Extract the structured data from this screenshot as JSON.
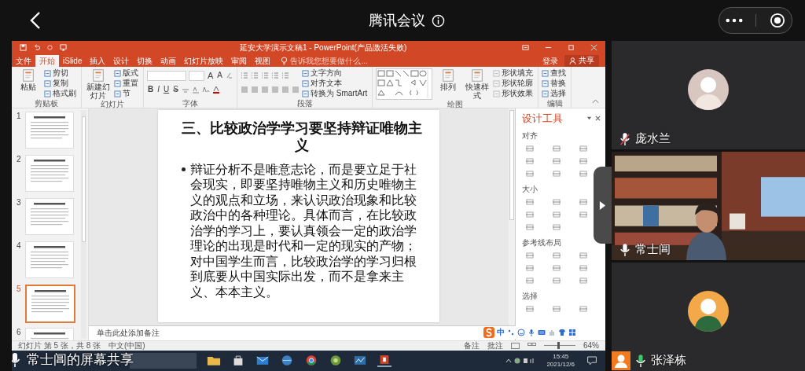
{
  "meeting": {
    "title": "腾讯会议"
  },
  "app": {
    "title": "延安大学演示文稿1 - PowerPoint(产品激活失败)",
    "tabs": [
      {
        "label": "文件",
        "selected": false
      },
      {
        "label": "开始",
        "selected": true
      },
      {
        "label": "iSlide",
        "selected": false
      },
      {
        "label": "插入",
        "selected": false
      },
      {
        "label": "设计",
        "selected": false
      },
      {
        "label": "切换",
        "selected": false
      },
      {
        "label": "动画",
        "selected": false
      },
      {
        "label": "幻灯片放映",
        "selected": false
      },
      {
        "label": "审阅",
        "selected": false
      },
      {
        "label": "视图",
        "selected": false
      }
    ],
    "tell_me": "告诉我您想要做什么...",
    "sign_in": "登录",
    "share": "共享",
    "ribbon": [
      {
        "label": "剪贴板",
        "kind": "basic",
        "items": [
          {
            "kind": "large",
            "label": "粘贴"
          },
          {
            "kind": "small",
            "label": "剪切"
          },
          {
            "kind": "small",
            "label": "复制"
          },
          {
            "kind": "small",
            "label": "格式刷"
          }
        ]
      },
      {
        "label": "幻灯片",
        "kind": "basic",
        "items": [
          {
            "kind": "large",
            "label": "新建幻灯片"
          },
          {
            "kind": "small",
            "label": "版式"
          },
          {
            "kind": "small",
            "label": "重置"
          },
          {
            "kind": "small",
            "label": "节"
          }
        ]
      },
      {
        "label": "字体",
        "kind": "font",
        "items": [
          {
            "kind": "letter",
            "label": "A"
          },
          {
            "kind": "letter",
            "label": "A"
          },
          {
            "kind": "letter",
            "label": "B"
          },
          {
            "kind": "letter",
            "label": "I"
          },
          {
            "kind": "letter",
            "label": "U"
          },
          {
            "kind": "letter",
            "label": "S"
          }
        ]
      },
      {
        "label": "段落",
        "kind": "paragraph",
        "items": [
          {
            "kind": "small",
            "label": "文字方向"
          },
          {
            "kind": "small",
            "label": "对齐文本"
          },
          {
            "kind": "small",
            "label": "转换为 SmartArt"
          }
        ]
      },
      {
        "label": "绘图",
        "kind": "drawing",
        "items": [
          {
            "kind": "large",
            "label": "排列"
          },
          {
            "kind": "large",
            "label": "快速样式"
          },
          {
            "kind": "small",
            "label": "形状填充"
          },
          {
            "kind": "small",
            "label": "形状轮廓"
          },
          {
            "kind": "small",
            "label": "形状效果"
          }
        ]
      },
      {
        "label": "编辑",
        "kind": "basic",
        "items": [
          {
            "kind": "small",
            "label": "查找"
          },
          {
            "kind": "small",
            "label": "替换"
          },
          {
            "kind": "small",
            "label": "选择"
          }
        ]
      }
    ],
    "thumbnails": [
      {
        "number": "1",
        "selected": false
      },
      {
        "number": "2",
        "selected": false
      },
      {
        "number": "3",
        "selected": false
      },
      {
        "number": "4",
        "selected": false
      },
      {
        "number": "5",
        "selected": true
      },
      {
        "number": "6",
        "selected": false
      }
    ],
    "slide": {
      "title": "三、比较政治学学习要坚持辩证唯物主义",
      "bullets": [
        "辩证分析不是唯意志论，而是要立足于社会现实，即要坚持唯物主义和历史唯物主义的观点和立场，来认识政治现象和比较政治中的各种理论。具体而言，在比较政治学的学习上，要认真领会一定的政治学理论的出现是时代和一定的现实的产物；对中国学生而言，比较政治学的学习归根到底要从中国实际出发，而不是拿来主义、本本主义。"
      ]
    },
    "notes_placeholder": "单击此处添加备注",
    "design_panel": {
      "title": "设计工具",
      "sections": [
        "对齐",
        "大小",
        "参考线布局",
        "选择"
      ]
    },
    "status_bar": {
      "slide_info": "幻灯片 第 5 张，共 8 张",
      "language": "中文(中国)",
      "notes": "备注",
      "comments": "批注",
      "zoom_slider": {
        "level": 0.45
      },
      "zoom": "64%"
    },
    "ime": {
      "mode": "中"
    },
    "taskbar": {
      "time": "15:45",
      "date": "2021/12/6"
    }
  },
  "presenter_caption": "常士阊的屏幕共享",
  "participants": [
    {
      "name": "庞水兰",
      "muted": true,
      "speaking": false,
      "video": false,
      "host": false
    },
    {
      "name": "常士阊",
      "muted": false,
      "speaking": false,
      "video": true,
      "host": false
    },
    {
      "name": "张泽栋",
      "muted": false,
      "speaking": true,
      "video": false,
      "host": true
    }
  ]
}
